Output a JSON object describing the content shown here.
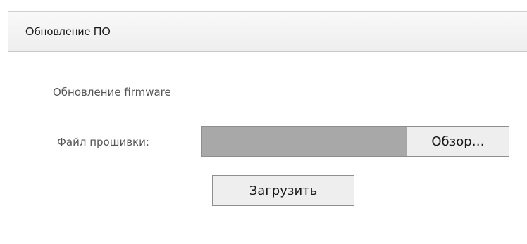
{
  "panel": {
    "title": "Обновление ПО"
  },
  "firmware_section": {
    "legend": "Обновление firmware",
    "file_label": "Файл прошивки:",
    "file_value": "",
    "browse_label": "Обзор…",
    "upload_label": "Загрузить"
  }
}
